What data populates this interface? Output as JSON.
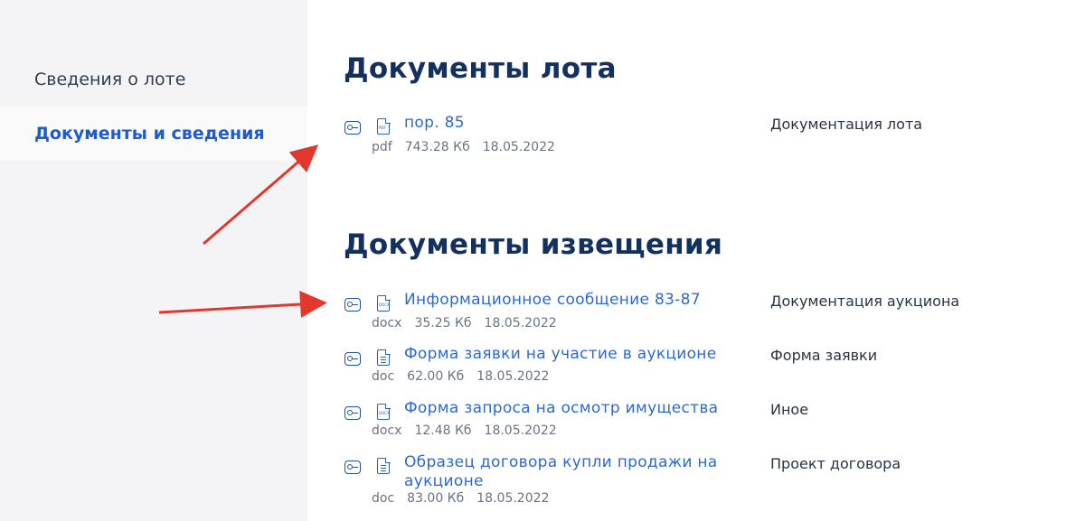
{
  "sidebar": {
    "items": [
      {
        "label": "Сведения о лоте",
        "active": false
      },
      {
        "label": "Документы и сведения",
        "active": true
      }
    ]
  },
  "sections": {
    "lot": {
      "title": "Документы лота",
      "docs": [
        {
          "name": "пор. 85",
          "ext": "pdf",
          "size": "743.28 Кб",
          "date": "18.05.2022",
          "category": "Документация лота",
          "icon": "pdf-file-icon"
        }
      ]
    },
    "notice": {
      "title": "Документы извещения",
      "docs": [
        {
          "name": "Информационное сообщение 83-87",
          "ext": "docx",
          "size": "35.25 Кб",
          "date": "18.05.2022",
          "category": "Документация аукциона",
          "icon": "docx-file-icon"
        },
        {
          "name": "Форма заявки на участие в аукционе",
          "ext": "doc",
          "size": "62.00 Кб",
          "date": "18.05.2022",
          "category": "Форма заявки",
          "icon": "doc-file-icon"
        },
        {
          "name": "Форма запроса на осмотр имущества",
          "ext": "docx",
          "size": "12.48 Кб",
          "date": "18.05.2022",
          "category": "Иное",
          "icon": "docx-file-icon"
        },
        {
          "name": "Образец договора купли продажи на аукционе",
          "ext": "doc",
          "size": "83.00 Кб",
          "date": "18.05.2022",
          "category": "Проект договора",
          "icon": "doc-file-icon"
        }
      ]
    }
  },
  "colors": {
    "accent": "#1f5cc9",
    "link": "#2e68d2",
    "heading": "#13305f",
    "annotation_arrow": "#e2372c"
  }
}
